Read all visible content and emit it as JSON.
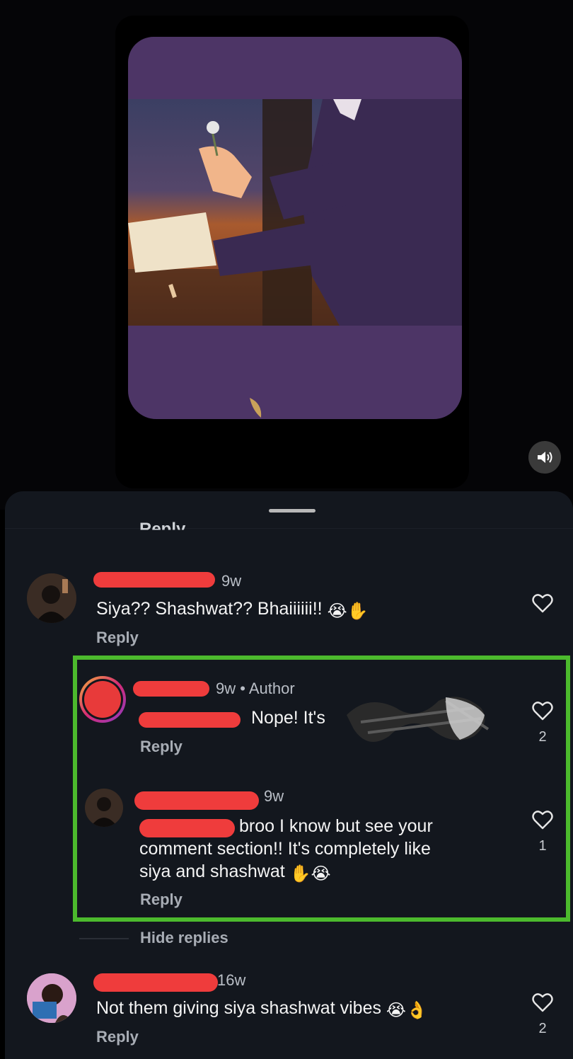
{
  "prev_reply_label": "Reply",
  "comments": [
    {
      "time": "9w",
      "text": "Siya?? Shashwat?? Bhaiiiiii!!",
      "emojis": "😭✋",
      "reply_label": "Reply",
      "likes": ""
    },
    {
      "time": "9w • Author",
      "text": "Nope! It's",
      "reply_label": "Reply",
      "likes": "2"
    },
    {
      "time": "9w",
      "line1": "broo I know but see your",
      "line2": "comment section!! It's completely like",
      "line3": "siya and shashwat",
      "emojis": "✋😭",
      "reply_label": "Reply",
      "likes": "1"
    },
    {
      "time": "16w",
      "text": "Not them giving siya shashwat vibes",
      "emojis": "😭👌",
      "reply_label": "Reply",
      "likes": "2"
    }
  ],
  "hide_replies_label": "Hide replies",
  "colors": {
    "highlight": "#4cba2d",
    "redaction": "#ef3c3c",
    "sheet": "#13171e"
  },
  "icons": [
    "speaker-icon",
    "heart-icon"
  ]
}
